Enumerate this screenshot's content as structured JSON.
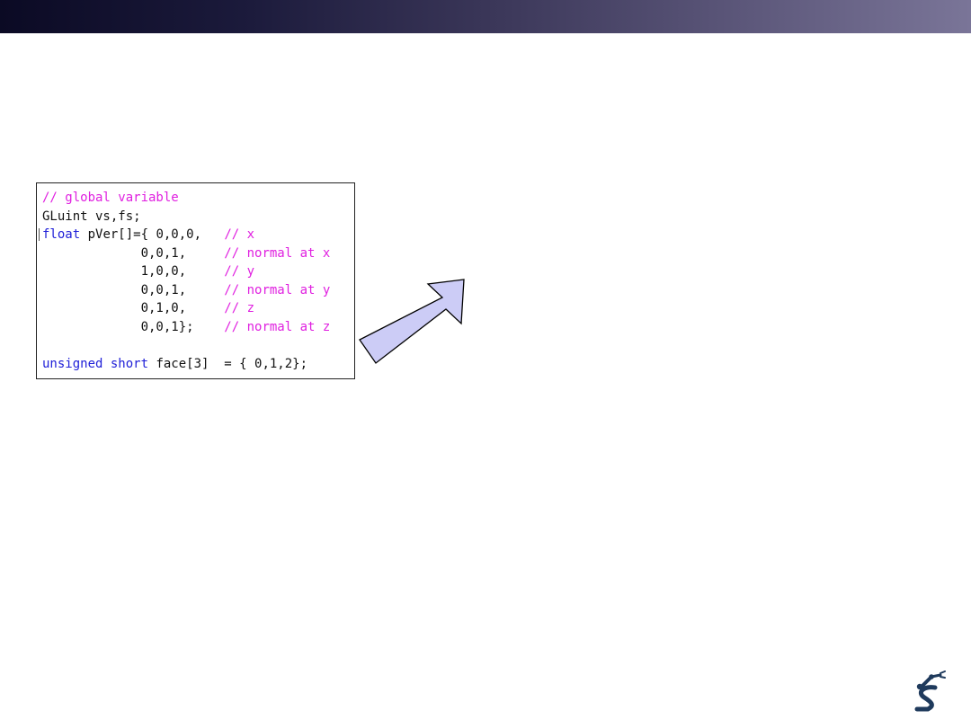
{
  "code": {
    "lines": [
      {
        "tokens": [
          {
            "text": "// global variable",
            "kind": "comment"
          }
        ]
      },
      {
        "tokens": [
          {
            "text": "GLuint vs,fs;",
            "kind": "plain"
          }
        ]
      },
      {
        "tokens": [
          {
            "text": "float",
            "kind": "keyword"
          },
          {
            "text": " pVer[]={ 0,0,0,   ",
            "kind": "plain"
          },
          {
            "text": "// x",
            "kind": "comment"
          }
        ]
      },
      {
        "tokens": [
          {
            "text": "             0,0,1,     ",
            "kind": "plain"
          },
          {
            "text": "// normal at x",
            "kind": "comment"
          }
        ]
      },
      {
        "tokens": [
          {
            "text": "             1,0,0,     ",
            "kind": "plain"
          },
          {
            "text": "// y",
            "kind": "comment"
          }
        ]
      },
      {
        "tokens": [
          {
            "text": "             0,0,1,     ",
            "kind": "plain"
          },
          {
            "text": "// normal at y",
            "kind": "comment"
          }
        ]
      },
      {
        "tokens": [
          {
            "text": "             0,1,0,     ",
            "kind": "plain"
          },
          {
            "text": "// z",
            "kind": "comment"
          }
        ]
      },
      {
        "tokens": [
          {
            "text": "             0,0,1};    ",
            "kind": "plain"
          },
          {
            "text": "// normal at z",
            "kind": "comment"
          }
        ]
      },
      {
        "tokens": [
          {
            "text": "",
            "kind": "plain"
          }
        ]
      },
      {
        "tokens": [
          {
            "text": "unsigned short",
            "kind": "keyword"
          },
          {
            "text": " face[3]  = { 0,1,2};",
            "kind": "plain"
          }
        ]
      }
    ]
  },
  "colors": {
    "comment": "#e020e0",
    "keyword": "#2020d8",
    "plain": "#111111",
    "arrow_fill": "#ccccf6",
    "arrow_stroke": "#000000",
    "header_start": "#0b0a24",
    "header_end": "#7a7598",
    "logo": "#1f3a5c"
  },
  "icons": {
    "arrow": "up-right-arrow",
    "logo": "robot-arm-logo"
  }
}
